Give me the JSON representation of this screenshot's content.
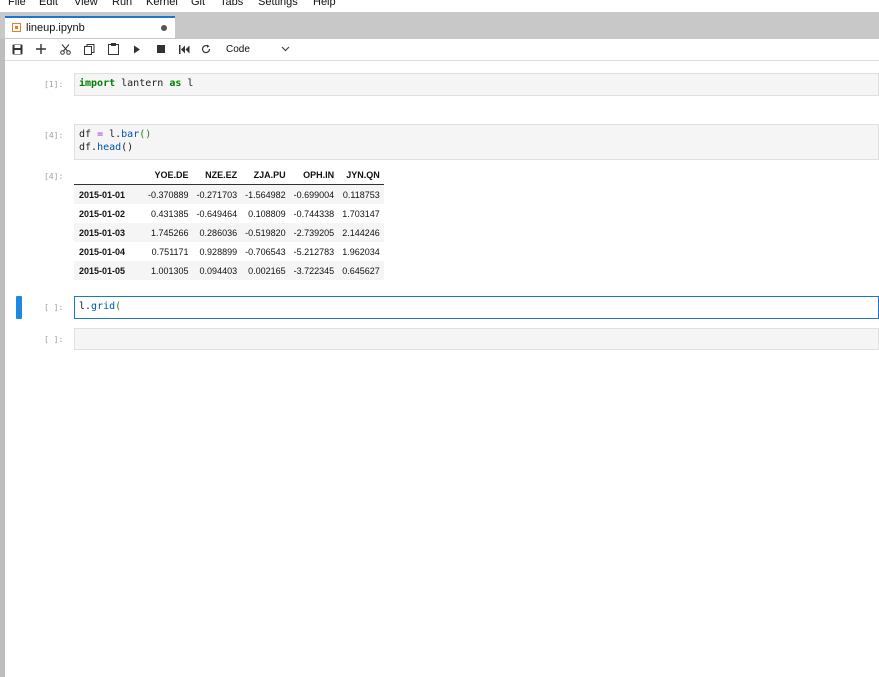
{
  "menu": [
    "File",
    "Edit",
    "View",
    "Run",
    "Kernel",
    "Git",
    "Tabs",
    "Settings",
    "Help"
  ],
  "tab": {
    "label": "lineup.ipynb"
  },
  "toolbar": {
    "cell_type": "Code"
  },
  "cells": [
    {
      "prompt": "[1]:",
      "code_parts": [
        "import",
        " lantern ",
        "as",
        " l"
      ]
    },
    {
      "prompt": "[4]:",
      "line1": [
        "df ",
        "=",
        " l.",
        "bar",
        "()"
      ],
      "line2": [
        "df.",
        "head",
        "()"
      ],
      "output_prompt": "[4]:"
    },
    {
      "prompt": "[ ]:",
      "code_parts": [
        "l.",
        "grid",
        "("
      ]
    },
    {
      "prompt": "[ ]:"
    }
  ],
  "table": {
    "columns": [
      "",
      "YOE.DE",
      "NZE.EZ",
      "ZJA.PU",
      "OPH.IN",
      "JYN.QN"
    ],
    "rows": [
      {
        "index": "2015-01-01",
        "values": [
          "-0.370889",
          "-0.271703",
          "-1.564982",
          "-0.699004",
          "0.118753"
        ]
      },
      {
        "index": "2015-01-02",
        "values": [
          "0.431385",
          "-0.649464",
          "0.108809",
          "-0.744338",
          "1.703147"
        ]
      },
      {
        "index": "2015-01-03",
        "values": [
          "1.745266",
          "0.286036",
          "-0.519820",
          "-2.739205",
          "2.144246"
        ]
      },
      {
        "index": "2015-01-04",
        "values": [
          "0.751171",
          "0.928899",
          "-0.706543",
          "-5.212783",
          "1.962034"
        ]
      },
      {
        "index": "2015-01-05",
        "values": [
          "1.001305",
          "0.094403",
          "0.002165",
          "-3.722345",
          "0.645627"
        ]
      }
    ]
  }
}
